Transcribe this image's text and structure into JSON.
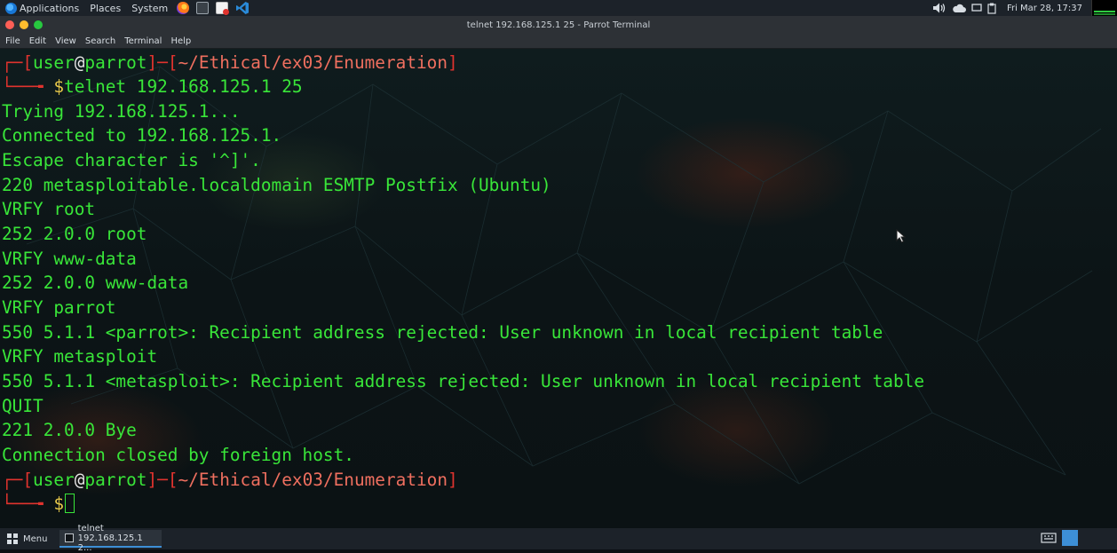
{
  "top_panel": {
    "applications": "Applications",
    "places": "Places",
    "system": "System",
    "clock": "Fri Mar 28, 17:37",
    "launchers": [
      "firefox-icon",
      "terminal-icon",
      "text-editor-icon",
      "vscode-icon"
    ],
    "tray": [
      "volume-icon",
      "weather-icon",
      "battery-icon",
      "clipboard-icon",
      "network-icon"
    ]
  },
  "window": {
    "title": "telnet 192.168.125.1 25 - Parrot Terminal",
    "menu": [
      "File",
      "Edit",
      "View",
      "Search",
      "Terminal",
      "Help"
    ]
  },
  "terminal": {
    "prompt1": {
      "user": "user",
      "at": "@",
      "host": "parrot",
      "path": "~/Ethical/ex03/Enumeration",
      "command": "telnet 192.168.125.1 25"
    },
    "output": [
      "Trying 192.168.125.1...",
      "Connected to 192.168.125.1.",
      "Escape character is '^]'.",
      "220 metasploitable.localdomain ESMTP Postfix (Ubuntu)",
      "VRFY root",
      "252 2.0.0 root",
      "VRFY www-data",
      "252 2.0.0 www-data",
      "VRFY parrot",
      "550 5.1.1 <parrot>: Recipient address rejected: User unknown in local recipient table",
      "VRFY metasploit",
      "550 5.1.1 <metasploit>: Recipient address rejected: User unknown in local recipient table",
      "QUIT",
      "221 2.0.0 Bye",
      "Connection closed by foreign host."
    ],
    "prompt2": {
      "user": "user",
      "at": "@",
      "host": "parrot",
      "path": "~/Ethical/ex03/Enumeration",
      "command": ""
    },
    "colors": {
      "text": "#39e639",
      "bracket": "#e0332e",
      "path": "#ef6f5f",
      "background": "#0f1c1e"
    }
  },
  "taskbar": {
    "menu_label": "Menu",
    "task_label": "telnet 192.168.125.1 2..."
  }
}
